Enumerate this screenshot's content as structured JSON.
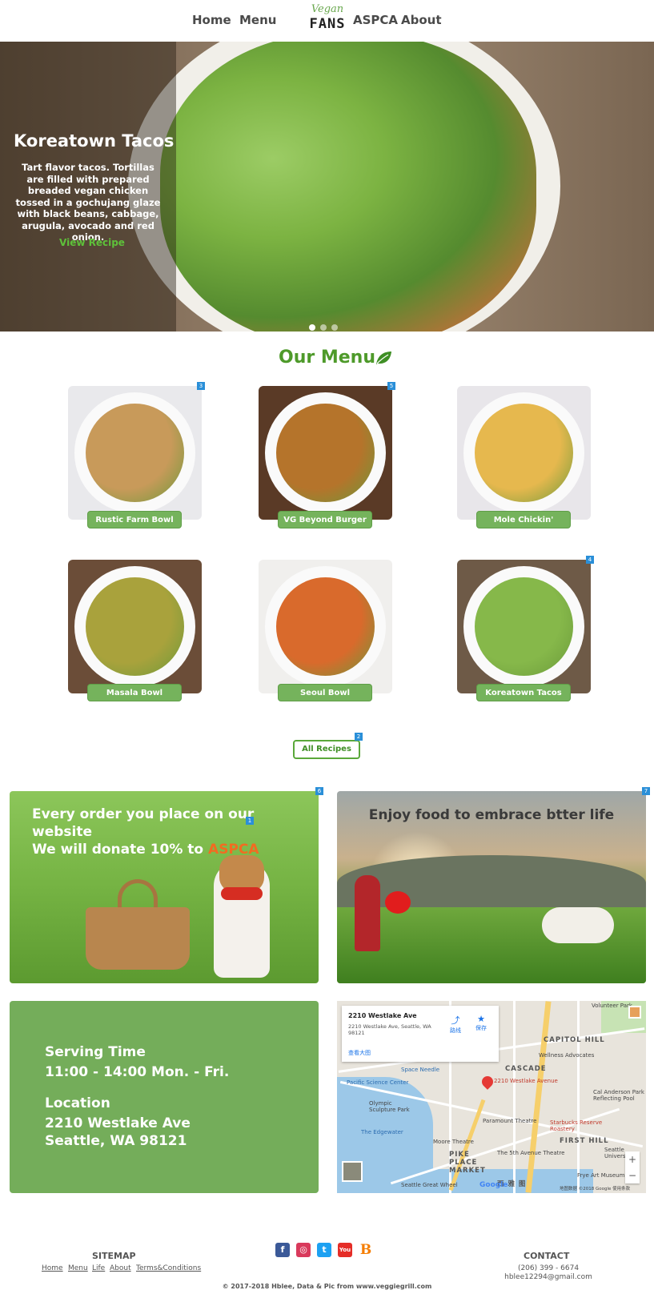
{
  "nav": {
    "items": [
      "Home",
      "Menu",
      "ASPCA",
      "About"
    ],
    "logo_top": "Vegan",
    "logo_bottom": "FANS"
  },
  "hero": {
    "title": "Koreatown Tacos",
    "description": "Tart flavor tacos. Tortillas are filled with prepared breaded vegan chicken tossed in a gochujang glaze with black beans, cabbage, arugula, avocado and red onion.",
    "link": "View Recipe",
    "slides": 3,
    "active_slide": 1
  },
  "menu": {
    "title": "Our Menu",
    "items": [
      {
        "label": "Rustic Farm Bowl",
        "badge": "3",
        "bg": "#e9e9ec",
        "food": "#c89a5a"
      },
      {
        "label": "VG Beyond Burger",
        "badge": "5",
        "bg": "#5a3a26",
        "food": "#b5742b"
      },
      {
        "label": "Mole Chickin' Burrito",
        "badge": "",
        "bg": "#e8e6ea",
        "food": "#e6b84e"
      },
      {
        "label": "Masala Bowl",
        "badge": "",
        "bg": "#6b4d38",
        "food": "#a9a23c"
      },
      {
        "label": "Seoul Bowl",
        "badge": "",
        "bg": "#f0efed",
        "food": "#d96a2c"
      },
      {
        "label": "Koreatown Tacos",
        "badge": "4",
        "bg": "#6e5a47",
        "food": "#86b84a"
      }
    ],
    "all_button": "All Recipes",
    "all_badge": "2"
  },
  "promo": {
    "left_line1": "Every order you place on our website",
    "left_line2": "We will donate 10% to ",
    "left_highlight": "ASPCA",
    "left_badge": "6",
    "left_badge2": "1",
    "right_text": "Enjoy food to embrace btter life",
    "right_badge": "7"
  },
  "info": {
    "serving_heading": "Serving Time",
    "serving_value": "11:00 - 14:00 Mon. - Fri.",
    "location_heading": "Location",
    "location_line1": "2210 Westlake Ave",
    "location_line2": "Seattle, WA 98121"
  },
  "map": {
    "card_title": "2210 Westlake Ave",
    "card_address": "2210 Westlake Ave, Seattle, WA 98121",
    "card_link": "查看大图",
    "directions": "路线",
    "save": "保存",
    "labels": {
      "capitol_hill": "CAPITOL HILL",
      "cascade": "CASCADE",
      "first_hill": "FIRST HILL",
      "pike_place": "PIKE PLACE MARKET",
      "space_needle": "Space Needle",
      "pacific_science": "Pacific Science Center",
      "edgewater": "The Edgewater",
      "moore": "Moore Theatre",
      "paramount": "Paramount Theatre",
      "fifth_ave": "The 5th Avenue Theatre",
      "starbucks": "Starbucks Reserve Roastery",
      "wellness": "Wellness Advocates",
      "cal_anderson": "Cal Anderson Park Reflecting Pool",
      "seattle_university": "Seattle University",
      "pin_label": "2210 Westlake Avenue",
      "sculpture": "Olympic Sculpture Park",
      "frye": "Frye Art Museum",
      "great_wheel": "Seattle Great Wheel",
      "volunteer": "Volunteer Park",
      "seattle": "西 雅 图"
    },
    "google": "Google",
    "copyright": "地图数据 ©2018 Google  使用条款"
  },
  "footer": {
    "sitemap_heading": "SITEMAP",
    "sitemap_links": [
      "Home",
      "Menu",
      "Life",
      "About",
      "Terms&Conditions"
    ],
    "contact_heading": "CONTACT",
    "phone": "(206) 399 - 6674",
    "email": "hblee12294@gmail.com",
    "copyright": "© 2017-2018 Hblee, Data & Pic from www.veggiegrill.com",
    "social": [
      {
        "icon": "facebook-icon",
        "glyph": "f",
        "color": "#3b5998"
      },
      {
        "icon": "instagram-icon",
        "glyph": "◎",
        "color": "#d93a5c"
      },
      {
        "icon": "twitter-icon",
        "glyph": "t",
        "color": "#1da1f2"
      },
      {
        "icon": "youtube-icon",
        "glyph": "You",
        "color": "#e52d27"
      },
      {
        "icon": "blogger-icon",
        "glyph": "B",
        "color": "#f57d00"
      }
    ]
  }
}
